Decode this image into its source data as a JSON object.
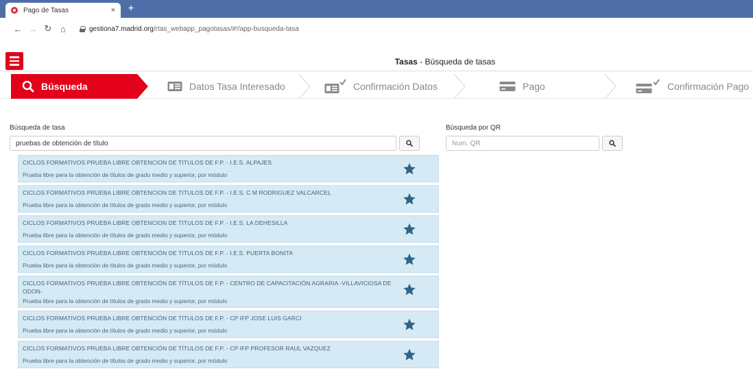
{
  "browser": {
    "tab_title": "Pago de Tasas",
    "tab_close": "×",
    "new_tab": "+",
    "url_host": "gestiona7.madrid.org",
    "url_path": "/rtas_webapp_pagotasas/#!/app-busqueda-tasa"
  },
  "header": {
    "title_bold": "Tasas",
    "title_rest": " - Búsqueda de tasas"
  },
  "steps": [
    {
      "label": "Búsqueda",
      "icon": "search-icon",
      "active": true
    },
    {
      "label": "Datos Tasa Interesado",
      "icon": "id-card-icon",
      "active": false
    },
    {
      "label": "Confirmación Datos",
      "icon": "id-card-check-icon",
      "active": false
    },
    {
      "label": "Pago",
      "icon": "credit-card-icon",
      "active": false
    },
    {
      "label": "Confirmación Pago",
      "icon": "credit-card-check-icon",
      "active": false
    }
  ],
  "search": {
    "label": "Búsqueda de tasa",
    "value": "pruebas de obtención de título"
  },
  "qr": {
    "label": "Búsqueda por QR",
    "placeholder": "Num. QR"
  },
  "results": [
    {
      "title": "CICLOS FORMATIVOS PRUEBA LIBRE OBTENCION DE TITULOS DE F.P. - I.E.S. ALPAJES",
      "desc": "Prueba libre para la obtención de títulos de grado medio y superior, por módulo"
    },
    {
      "title": "CICLOS FORMATIVOS PRUEBA LIBRE OBTENCION DE TITULOS DE F.P. - I.E.S. C M RODRIGUEZ VALCARCEL",
      "desc": "Prueba libre para la obtención de títulos de grado medio y superior, por módulo"
    },
    {
      "title": "CICLOS FORMATIVOS PRUEBA LIBRE OBTENCION DE TITULOS DE F.P. - I.E.S. LA DEHESILLA",
      "desc": "Prueba libre para la obtención de títulos de grado medio y superior, por módulo"
    },
    {
      "title": "CICLOS FORMATIVOS PRUEBA LIBRE OBTENCIÓN DE TITULOS DE F.P. - I.E.S. PUERTA BONITA",
      "desc": "Prueba libre para la obtención de títulos de grado medio y superior, por módulo"
    },
    {
      "title": "CICLOS FORMATIVOS PRUEBA LIBRE OBTENCIÓN DE TÍTULOS DE F.P. - CENTRO DE CAPACITACIÓN AGRARIA -VILLAVICIOSA DE ODON-",
      "desc": "Prueba libre para la obtención de títulos de grado medio y superior, por módulo"
    },
    {
      "title": "CICLOS FORMATIVOS PRUEBA LIBRE OBTENCIÓN DE TÍTULOS DE F.P. - CP IFP JOSE LUIS GARCI",
      "desc": "Prueba libre para la obtención de títulos de grado medio y superior, por módulo"
    },
    {
      "title": "CICLOS FORMATIVOS PRUEBA LIBRE OBTENCIÓN DE TÍTULOS DE F.P. - CP IFP PROFESOR RAUL VAZQUEZ",
      "desc": "Prueba libre para la obtención de títulos de grado medio y superior, por módulo"
    }
  ],
  "colors": {
    "brand_red": "#e2001a",
    "result_bg": "#d5eaf5",
    "star": "#2f6488"
  }
}
